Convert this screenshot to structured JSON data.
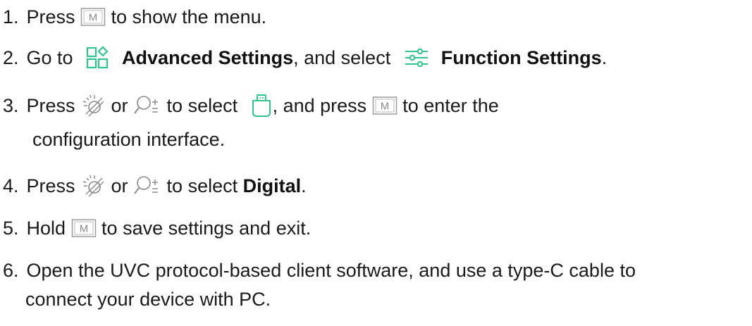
{
  "steps": [
    {
      "num": "1.",
      "t1": " Press ",
      "t2": " to show the menu."
    },
    {
      "num": "2.",
      "t1": " Go to ",
      "bold1": "Advanced Settings",
      "t2": ", and select ",
      "bold2": "Function Settings",
      "t3": "."
    },
    {
      "num": "3.",
      "t1": " Press ",
      "t2": " or ",
      "t3": " to select ",
      "t4": ", and press ",
      "t5": " to enter the",
      "cont": "configuration interface."
    },
    {
      "num": "4.",
      "t1": " Press ",
      "t2": " or ",
      "t3": " to select ",
      "bold1": "Digital",
      "t4": "."
    },
    {
      "num": "5.",
      "t1": " Hold ",
      "t2": " to save settings and exit."
    },
    {
      "num": "6.",
      "t1": " Open the UVC protocol-based client software, and use a type-C cable to",
      "cont": "connect your device with PC."
    }
  ],
  "icons": {
    "menu_key_glyph": "M",
    "menu_key": "menu-button-icon",
    "advanced": "advanced-settings-icon",
    "function": "function-settings-icon",
    "brightness": "brightness-icon",
    "zoom": "zoom-icon",
    "usb": "usb-mode-icon"
  },
  "colors": {
    "accent": "#31c48d",
    "text": "#1a1a1a",
    "key_border": "#9a9a9a"
  }
}
